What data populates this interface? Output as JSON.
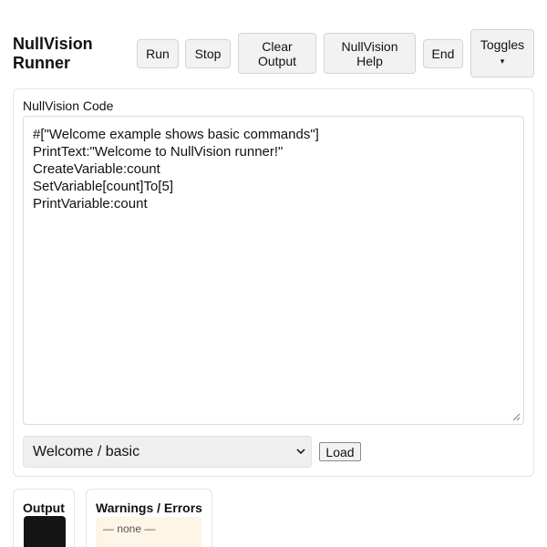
{
  "app": {
    "title": "NullVision Runner"
  },
  "toolbar": {
    "run_label": "Run",
    "stop_label": "Stop",
    "clear_output_label": "Clear Output",
    "help_label": "NullVision Help",
    "end_label": "End",
    "toggles_label": "Toggles",
    "toggles_caret": "▾"
  },
  "editor": {
    "label": "NullVision Code",
    "lines": [
      "#[\"Welcome example shows basic commands\"]",
      "PrintText:\"Welcome to NullVision runner!\"",
      "CreateVariable:count",
      "SetVariable[count]To[5]",
      "PrintVariable:count"
    ]
  },
  "examples": {
    "selected": "Welcome / basic",
    "load_label": "Load"
  },
  "output": {
    "title": "Output"
  },
  "warnings": {
    "title": "Warnings / Errors",
    "empty_text": "— none —"
  },
  "colors": {
    "console_bg": "#141414",
    "warning_bg": "#fdf6e6",
    "button_bg": "#f2f2f2"
  },
  "icons": {
    "toggles_dropdown": "caret-down-icon",
    "select_dropdown": "chevron-down-icon",
    "textarea_resize": "resize-grip-icon"
  }
}
